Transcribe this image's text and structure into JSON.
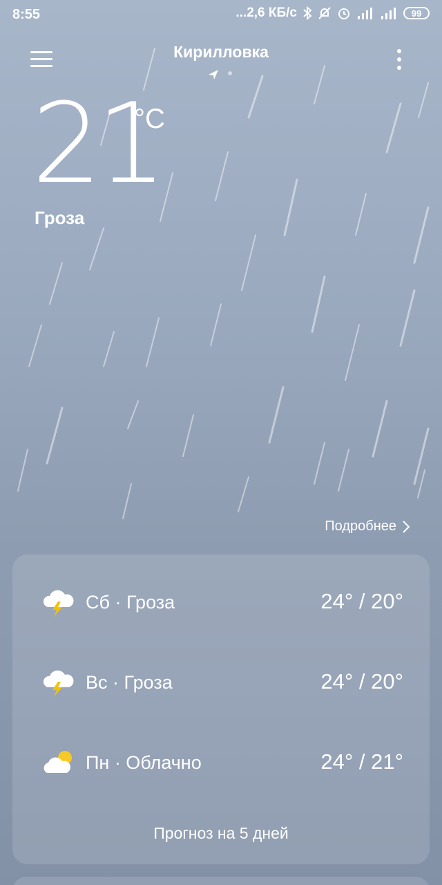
{
  "status_bar": {
    "time": "8:55",
    "network_speed": "...2,6 КБ/с",
    "battery": "99",
    "icons": [
      "bluetooth-icon",
      "mute-icon",
      "alarm-icon",
      "signal-icon",
      "signal-icon",
      "battery-icon"
    ]
  },
  "header": {
    "city": "Кирилловка",
    "menu_icon": "hamburger-menu-icon",
    "more_icon": "vertical-dots-icon",
    "location_icon": "location-arrow-icon"
  },
  "current": {
    "temperature": "21",
    "unit": "°C",
    "condition": "Гроза"
  },
  "details_link": "Подробнее",
  "forecast": {
    "days": [
      {
        "label": "Сб · Гроза",
        "temps": "24° / 20°",
        "icon": "thunderstorm-icon"
      },
      {
        "label": "Вс · Гроза",
        "temps": "24° / 20°",
        "icon": "thunderstorm-icon"
      },
      {
        "label": "Пн · Облачно",
        "temps": "24° / 21°",
        "icon": "partly-cloudy-icon"
      }
    ],
    "footer": "Прогноз на 5 дней"
  },
  "colors": {
    "background_top": "#a8b6ca",
    "background_bottom": "#8391a7",
    "text": "#ffffff",
    "lightning": "#f2c200",
    "sun": "#f7c928"
  }
}
